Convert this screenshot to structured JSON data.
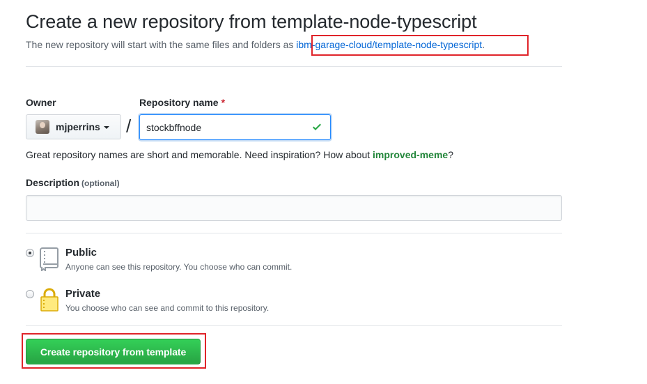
{
  "header": {
    "title": "Create a new repository from template-node-typescript",
    "subtitle_prefix": "The new repository will start with the same files and folders as ",
    "template_link": "ibm-garage-cloud/template-node-typescript",
    "subtitle_suffix": "."
  },
  "owner": {
    "label": "Owner",
    "value": "mjperrins",
    "avatar_icon": "user-avatar"
  },
  "separator": "/",
  "repo_name": {
    "label": "Repository name",
    "required_mark": "*",
    "value": "stockbffnode",
    "status_icon": "check-icon",
    "status_color": "#28a745"
  },
  "hint": {
    "prefix": "Great repository names are short and memorable. Need inspiration? How about ",
    "suggestion": "improved-meme",
    "suffix": "?"
  },
  "description": {
    "label": "Description",
    "optional_text": "(optional)",
    "value": ""
  },
  "visibility": {
    "options": [
      {
        "title": "Public",
        "description": "Anyone can see this repository. You choose who can commit.",
        "selected": true,
        "icon": "repo-book-icon"
      },
      {
        "title": "Private",
        "description": "You choose who can see and commit to this repository.",
        "selected": false,
        "icon": "lock-icon"
      }
    ]
  },
  "submit": {
    "label": "Create repository from template",
    "color": "#28a745"
  },
  "highlight_color": "#e0242a"
}
